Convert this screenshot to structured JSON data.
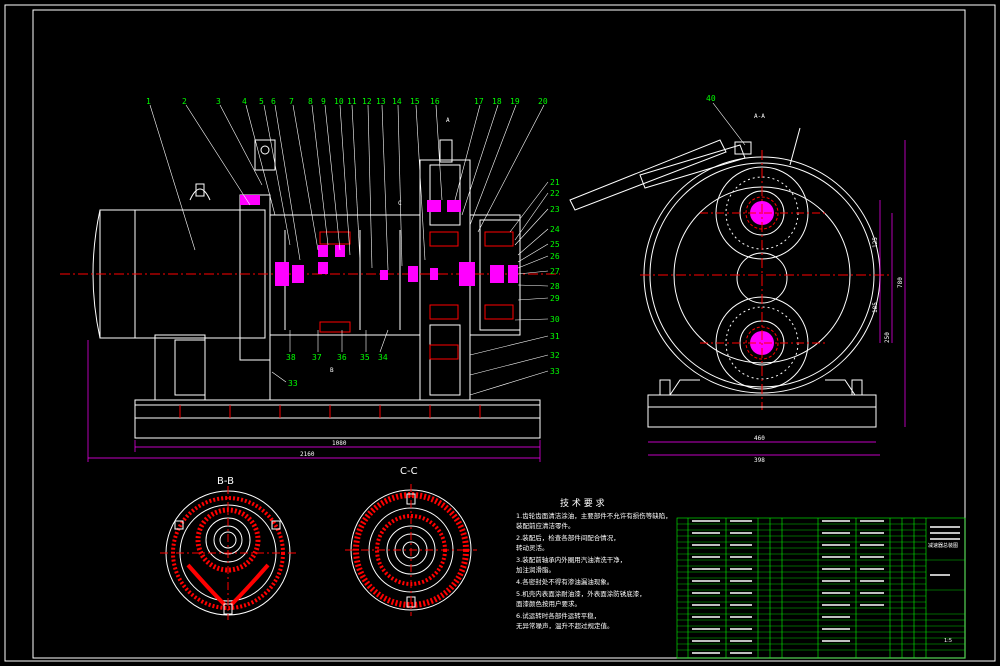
{
  "colors": {
    "background": "#000000",
    "outline": "#ffffff",
    "part_label": "#00ff00",
    "dimension": "#ff00ff",
    "hatch": "#ff0000",
    "bearing": "#ff00ff",
    "center_line": "#ff0000",
    "table_line": "#00ff00"
  },
  "part_labels_top": [
    "1",
    "2",
    "3",
    "4",
    "5",
    "6",
    "7",
    "8",
    "9",
    "10",
    "11",
    "12",
    "13",
    "14",
    "15",
    "16",
    "17",
    "18",
    "19",
    "20"
  ],
  "part_labels_right": [
    "21",
    "22",
    "23",
    "24",
    "25",
    "26",
    "27",
    "28",
    "29",
    "30",
    "31",
    "32",
    "33"
  ],
  "part_labels_bottom": [
    "38",
    "37",
    "36",
    "35",
    "34",
    "33"
  ],
  "part_label_side_view": "40",
  "section_labels": {
    "bb": "B-B",
    "cc": "C-C",
    "side_view": "A-A",
    "cut_a": "A",
    "cut_b": "B",
    "cut_c": "C"
  },
  "dimensions": {
    "inner_width": "1080",
    "overall_width": "2160",
    "side_base_width": "460",
    "side_overall_width": "398",
    "side_height_1": "125",
    "side_height_2": "185",
    "side_height_3": "250",
    "side_overall_height": "780"
  },
  "technical_requirements": {
    "title": "技 术 要 求",
    "lines": [
      "1.齿轮齿面清洁涂油，主要部件不允许有损伤等缺陷，",
      "  装配前应清洁零件。",
      "2.装配后，检查各部件间配合情况，",
      "  转动灵活。",
      "3.装配前轴承内外圈用汽油清洗干净，",
      "  加注润滑脂。",
      "4.各密封处不得有渗油漏油现象。",
      "5.机壳内表面涂耐油漆，外表面涂防锈底漆，",
      "  面漆颜色按用户要求。",
      "6.试运转时各部件运转平稳，",
      "  无异常噪声，温升不超过规定值。"
    ]
  },
  "title_block": {
    "drawing_title": "减速器总装图",
    "scale": "1:5"
  }
}
